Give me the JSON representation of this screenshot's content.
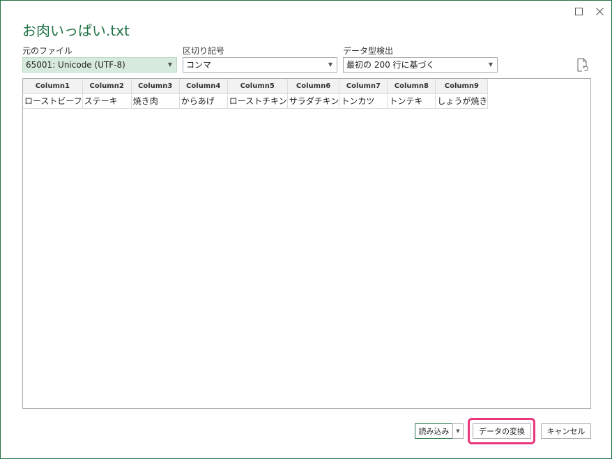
{
  "window": {
    "title": "お肉いっぱい.txt",
    "maximize_icon": "□",
    "close_icon": "✕"
  },
  "fields": {
    "file_origin": {
      "label": "元のファイル",
      "value": "65001: Unicode (UTF-8)"
    },
    "delimiter": {
      "label": "区切り記号",
      "value": "コンマ"
    },
    "type_detection": {
      "label": "データ型検出",
      "value": "最初の 200 行に基づく"
    }
  },
  "refresh_icon": "refresh-document-icon",
  "table": {
    "columns": [
      "Column1",
      "Column2",
      "Column3",
      "Column4",
      "Column5",
      "Column6",
      "Column7",
      "Column8",
      "Column9"
    ],
    "rows": [
      [
        "ローストビーフ",
        "ステーキ",
        "焼き肉",
        "からあげ",
        "ローストチキン",
        "サラダチキン",
        "トンカツ",
        "トンテキ",
        "しょうが焼き"
      ]
    ]
  },
  "buttons": {
    "load": "読み込み",
    "transform": "データの変換",
    "cancel": "キャンセル"
  },
  "colors": {
    "accent": "#217346",
    "highlight": "#e8377a"
  }
}
